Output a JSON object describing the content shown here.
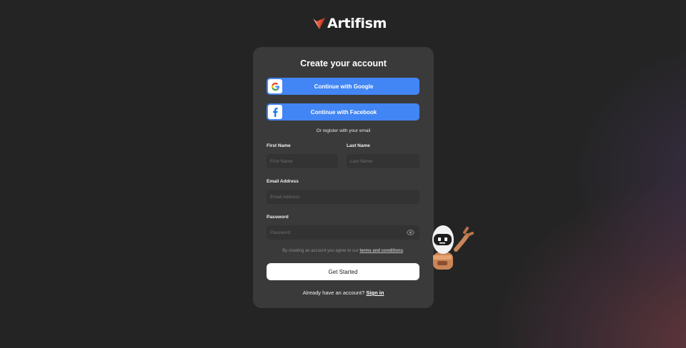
{
  "brand": {
    "name": "Artifism",
    "accent": "#e8553a"
  },
  "form": {
    "title": "Create your account",
    "google_label": "Continue with Google",
    "facebook_label": "Continue with Facebook",
    "or_text": "Or register with your email",
    "first_name": {
      "label": "First Name",
      "placeholder": "First Name"
    },
    "last_name": {
      "label": "Last Name",
      "placeholder": "Last Name"
    },
    "email": {
      "label": "Email Address",
      "placeholder": "Email Address"
    },
    "password": {
      "label": "Password",
      "placeholder": "Password"
    },
    "terms_prefix": "By creating an account you agree to our",
    "terms_link": "terms and conditions",
    "terms_suffix": ".",
    "submit_label": "Get Started",
    "signin_prefix": "Already have an account?",
    "signin_link": "Sign in"
  },
  "colors": {
    "background": "#222222",
    "card": "#3a3a3a",
    "social_button": "#4285f4",
    "primary_button": "#ffffff"
  },
  "icons": [
    "logo-icon",
    "google-icon",
    "facebook-icon",
    "eye-icon",
    "robot-mascot"
  ]
}
